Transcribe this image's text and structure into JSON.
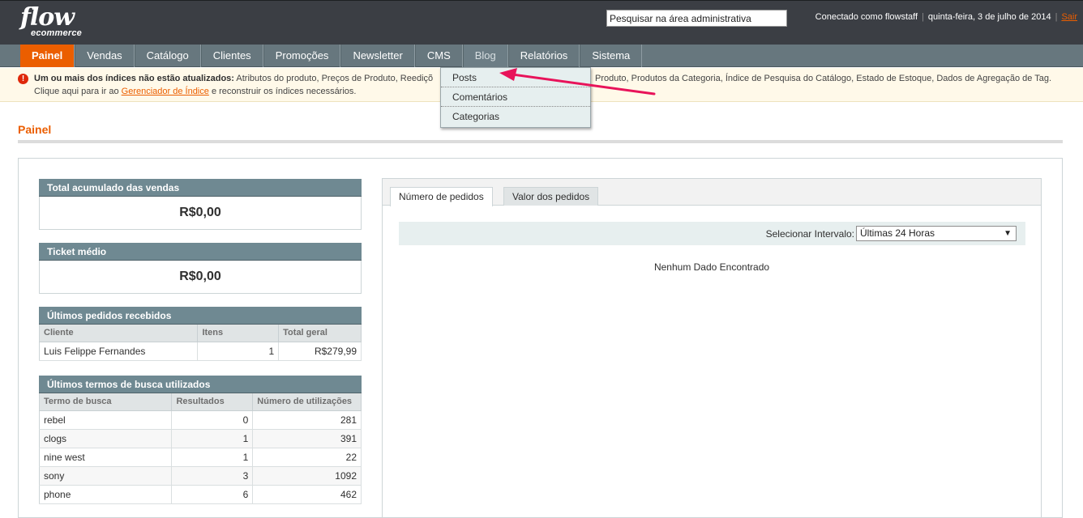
{
  "header": {
    "logo_main": "flow",
    "logo_sub": "ecommerce",
    "search_value": "Pesquisar na área administrativa",
    "logged_in": "Conectado como flowstaff",
    "date": "quinta-feira, 3 de julho de 2014",
    "logout": "Sair"
  },
  "nav": {
    "items": [
      "Painel",
      "Vendas",
      "Catálogo",
      "Clientes",
      "Promoções",
      "Newsletter",
      "CMS",
      "Blog",
      "Relatórios",
      "Sistema"
    ]
  },
  "blog_menu": {
    "items": [
      "Posts",
      "Comentários",
      "Categorias"
    ]
  },
  "notice": {
    "icon": "!",
    "bold": "Um ou mais dos índices não estão atualizados:",
    "text_left": "Atributos do produto, Preços de Produto, Reediçõ",
    "text_right": "Produto, Produtos da Categoria, Índice de Pesquisa do Catálogo, Estado de Estoque, Dados de Agregação de Tag.",
    "line2_before": "Clique aqui para ir ao",
    "line2_link": "Gerenciador de Índice",
    "line2_after": "e reconstruir os índices necessários."
  },
  "page": {
    "title": "Painel"
  },
  "widgets": {
    "total_sales": {
      "title": "Total acumulado das vendas",
      "value": "R$0,00"
    },
    "avg_ticket": {
      "title": "Ticket médio",
      "value": "R$0,00"
    },
    "last_orders": {
      "title": "Últimos pedidos recebidos",
      "columns": [
        "Cliente",
        "Itens",
        "Total geral"
      ],
      "rows": [
        [
          "Luis Felippe Fernandes",
          "1",
          "R$279,99"
        ]
      ]
    },
    "last_search": {
      "title": "Últimos termos de busca utilizados",
      "columns": [
        "Termo de busca",
        "Resultados",
        "Número de utilizações"
      ],
      "rows": [
        [
          "rebel",
          "0",
          "281"
        ],
        [
          "clogs",
          "1",
          "391"
        ],
        [
          "nine west",
          "1",
          "22"
        ],
        [
          "sony",
          "3",
          "1092"
        ],
        [
          "phone",
          "6",
          "462"
        ]
      ]
    }
  },
  "chart": {
    "tabs": [
      "Número de pedidos",
      "Valor dos pedidos"
    ],
    "range_label": "Selecionar Intervalo:",
    "range_value": "Últimas 24 Horas",
    "empty": "Nenhum Dado Encontrado"
  },
  "colors": {
    "accent": "#eb5e00",
    "header_bg": "#3b3e44",
    "nav_bg": "#67777e",
    "widget_head": "#6f8992",
    "annotation_arrow": "#e8135a"
  }
}
